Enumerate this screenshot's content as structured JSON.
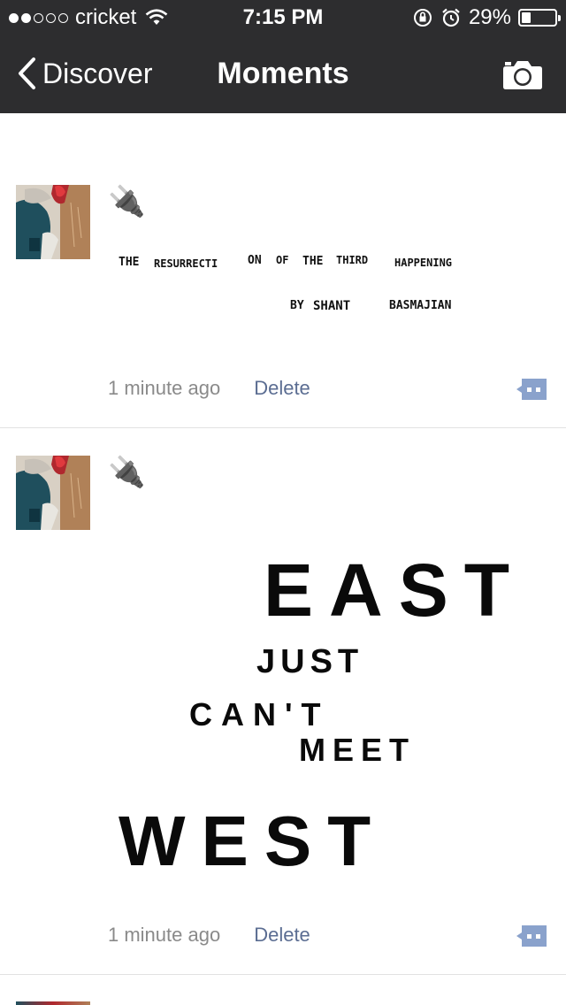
{
  "status_bar": {
    "carrier": "cricket",
    "signal_filled": 2,
    "signal_total": 5,
    "time": "7:15 PM",
    "battery_percent": "29%",
    "battery_level": 0.29
  },
  "nav": {
    "back_label": "Discover",
    "title": "Moments",
    "camera_icon": "camera-icon"
  },
  "posts": [
    {
      "emoji": "🔌",
      "image_text": {
        "line1": [
          "THE",
          "RESURRECTI",
          "ON",
          "OF",
          "THE",
          "THIRD",
          "HAPPENING"
        ],
        "line2": [
          "BY",
          "SHANT",
          "BASMAJIAN"
        ]
      },
      "time": "1 minute ago",
      "delete_label": "Delete"
    },
    {
      "emoji": "🔌",
      "image_text": {
        "east": "EAST",
        "just": "JUST",
        "cant": "CAN'T",
        "meet": "MEET",
        "west": "WEST"
      },
      "time": "1 minute ago",
      "delete_label": "Delete"
    }
  ],
  "colors": {
    "nav_bg": "#2d2d2f",
    "link": "#5b6d92",
    "meta": "#8a8a8a",
    "comment_btn": "#8aa2cc"
  }
}
